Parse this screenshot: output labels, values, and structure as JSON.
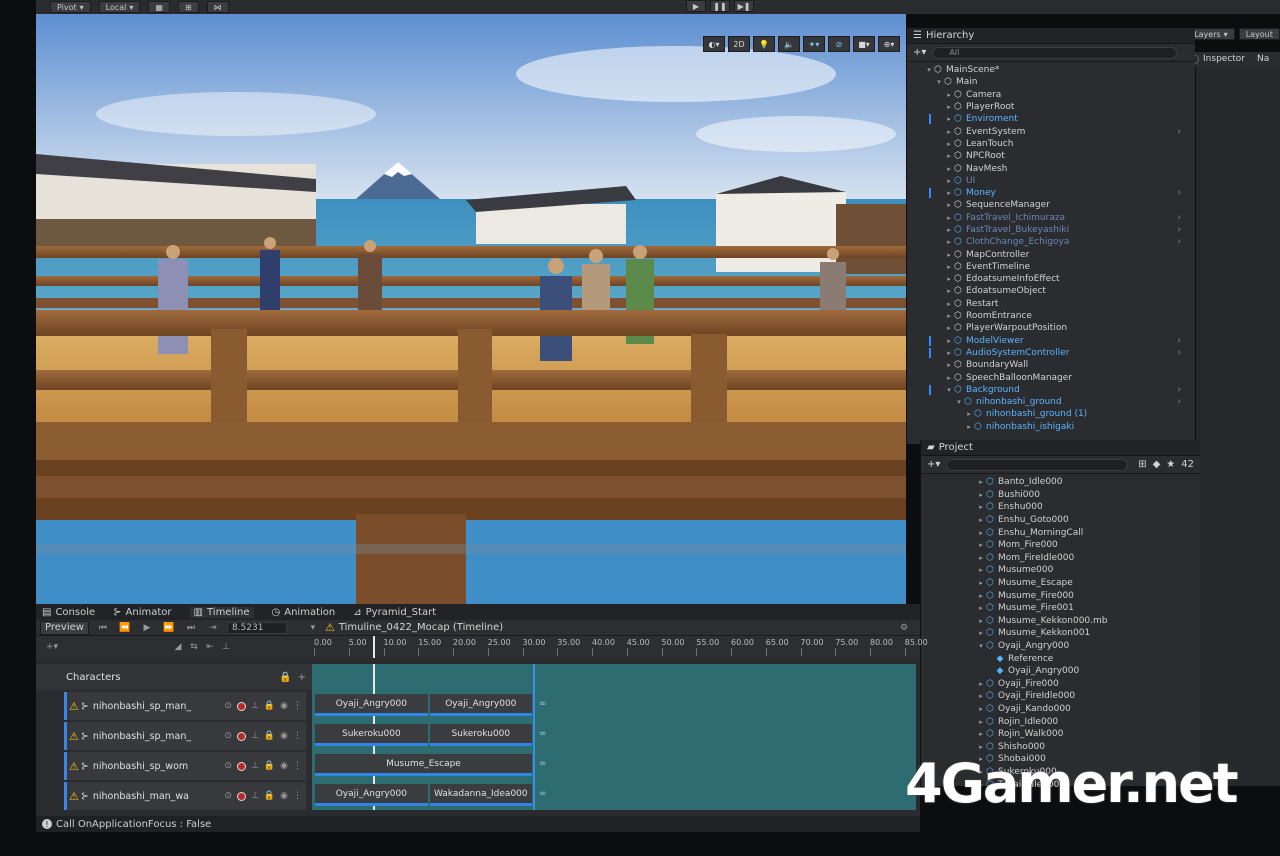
{
  "toolbar": {
    "pivot_label": "Pivot",
    "local_label": "Local",
    "play_icon": "play-icon",
    "pause_icon": "pause-icon",
    "step_icon": "step-icon"
  },
  "scene": {
    "mode_2d": "2D"
  },
  "hierarchy": {
    "title": "Hierarchy",
    "search_placeholder": "All",
    "items": [
      {
        "label": "MainScene*",
        "depth": 0,
        "style": "normal"
      },
      {
        "label": "Main",
        "depth": 1,
        "style": "normal"
      },
      {
        "label": "Camera",
        "depth": 2,
        "style": "normal"
      },
      {
        "label": "PlayerRoot",
        "depth": 2,
        "style": "normal"
      },
      {
        "label": "Enviroment",
        "depth": 2,
        "style": "blue"
      },
      {
        "label": "EventSystem",
        "depth": 2,
        "style": "normal"
      },
      {
        "label": "LeanTouch",
        "depth": 2,
        "style": "normal"
      },
      {
        "label": "NPCRoot",
        "depth": 2,
        "style": "normal"
      },
      {
        "label": "NavMesh",
        "depth": 2,
        "style": "normal"
      },
      {
        "label": "UI",
        "depth": 2,
        "style": "faint"
      },
      {
        "label": "Money",
        "depth": 2,
        "style": "blue"
      },
      {
        "label": "SequenceManager",
        "depth": 2,
        "style": "normal"
      },
      {
        "label": "FastTravel_Ichimuraza",
        "depth": 2,
        "style": "faint"
      },
      {
        "label": "FastTravel_Bukeyashiki",
        "depth": 2,
        "style": "faint"
      },
      {
        "label": "ClothChange_Echigoya",
        "depth": 2,
        "style": "faint"
      },
      {
        "label": "MapController",
        "depth": 2,
        "style": "normal"
      },
      {
        "label": "EventTimeline",
        "depth": 2,
        "style": "normal"
      },
      {
        "label": "EdoatsumeInfoEffect",
        "depth": 2,
        "style": "normal"
      },
      {
        "label": "EdoatsumeObject",
        "depth": 2,
        "style": "normal"
      },
      {
        "label": "Restart",
        "depth": 2,
        "style": "normal"
      },
      {
        "label": "RoomEntrance",
        "depth": 2,
        "style": "normal"
      },
      {
        "label": "PlayerWarpoutPosition",
        "depth": 2,
        "style": "normal"
      },
      {
        "label": "ModelViewer",
        "depth": 2,
        "style": "blue"
      },
      {
        "label": "AudioSystemController",
        "depth": 2,
        "style": "blue"
      },
      {
        "label": "BoundaryWall",
        "depth": 2,
        "style": "normal"
      },
      {
        "label": "SpeechBalloonManager",
        "depth": 2,
        "style": "normal"
      },
      {
        "label": "Background",
        "depth": 2,
        "style": "blue"
      },
      {
        "label": "nihonbashi_ground",
        "depth": 3,
        "style": "blue"
      },
      {
        "label": "nihonbashi_ground (1)",
        "depth": 4,
        "style": "blue"
      },
      {
        "label": "nihonbashi_ishigaki",
        "depth": 4,
        "style": "blue"
      }
    ]
  },
  "right_tabs": {
    "layers_label": "Layers",
    "layout_label": "Layout",
    "inspector_label": "Inspector",
    "navigation_label": "Na"
  },
  "project": {
    "title": "Project",
    "count_badge": "42",
    "items": [
      {
        "label": "Banto_Idle000",
        "depth": 1
      },
      {
        "label": "Bushi000",
        "depth": 1
      },
      {
        "label": "Enshu000",
        "depth": 1
      },
      {
        "label": "Enshu_Goto000",
        "depth": 1
      },
      {
        "label": "Enshu_MorningCall",
        "depth": 1
      },
      {
        "label": "Mom_Fire000",
        "depth": 1
      },
      {
        "label": "Mom_FireIdle000",
        "depth": 1
      },
      {
        "label": "Musume000",
        "depth": 1
      },
      {
        "label": "Musume_Escape",
        "depth": 1
      },
      {
        "label": "Musume_Fire000",
        "depth": 1
      },
      {
        "label": "Musume_Fire001",
        "depth": 1
      },
      {
        "label": "Musume_Kekkon000.mb",
        "depth": 1
      },
      {
        "label": "Musume_Kekkon001",
        "depth": 1
      },
      {
        "label": "Oyaji_Angry000",
        "depth": 1,
        "open": true
      },
      {
        "label": "Reference",
        "depth": 2
      },
      {
        "label": "Oyaji_Angry000",
        "depth": 2
      },
      {
        "label": "Oyaji_Fire000",
        "depth": 1
      },
      {
        "label": "Oyaji_FireIdle000",
        "depth": 1
      },
      {
        "label": "Oyaji_Kando000",
        "depth": 1
      },
      {
        "label": "Rojin_Idle000",
        "depth": 1
      },
      {
        "label": "Rojin_Walk000",
        "depth": 1
      },
      {
        "label": "Shisho000",
        "depth": 1
      },
      {
        "label": "Shobai000",
        "depth": 1
      },
      {
        "label": "Sukeroku000",
        "depth": 1
      },
      {
        "label": "Tedai_Idle000",
        "depth": 1
      }
    ]
  },
  "bottom_tabs": [
    {
      "label": "Console",
      "icon": "console-icon"
    },
    {
      "label": "Animator",
      "icon": "animator-icon"
    },
    {
      "label": "Timeline",
      "icon": "timeline-icon"
    },
    {
      "label": "Animation",
      "icon": "animation-icon"
    },
    {
      "label": "Pyramid_Start",
      "icon": "pyramid-icon"
    }
  ],
  "timeline": {
    "preview_label": "Preview",
    "frame_value": "8.5231",
    "asset_name": "Timuline_0422_Mocap (Timeline)",
    "ticks": [
      "0.00",
      "5.00",
      "10.00",
      "15.00",
      "20.00",
      "25.00",
      "30.00",
      "35.00",
      "40.00",
      "45.00",
      "50.00",
      "55.00",
      "60.00",
      "65.00",
      "70.00",
      "75.00",
      "80.00",
      "85.00"
    ],
    "playhead_value": 8.5231,
    "end_value": 31.5,
    "group_label": "Characters",
    "tracks": [
      {
        "name": "nihonbashi_sp_man_",
        "clips": [
          {
            "label": "Oyaji_Angry000",
            "start": 0,
            "end": 16.5
          },
          {
            "label": "Oyaji_Angry000",
            "start": 16.5,
            "end": 31.5
          }
        ]
      },
      {
        "name": "nihonbashi_sp_man_",
        "clips": [
          {
            "label": "Sukeroku000",
            "start": 0,
            "end": 16.5
          },
          {
            "label": "Sukeroku000",
            "start": 16.5,
            "end": 31.5
          }
        ]
      },
      {
        "name": "nihonbashi_sp_wom",
        "clips": [
          {
            "label": "Musume_Escape",
            "start": 0,
            "end": 31.5
          }
        ]
      },
      {
        "name": "nihonbashi_man_wa",
        "clips": [
          {
            "label": "Oyaji_Angry000",
            "start": 0,
            "end": 16.5
          },
          {
            "label": "Wakadanna_Idea000",
            "start": 16.5,
            "end": 31.5
          }
        ]
      }
    ]
  },
  "status": {
    "message": "Call OnApplicationFocus : False"
  },
  "watermark": {
    "text": "4Gamer.net"
  }
}
